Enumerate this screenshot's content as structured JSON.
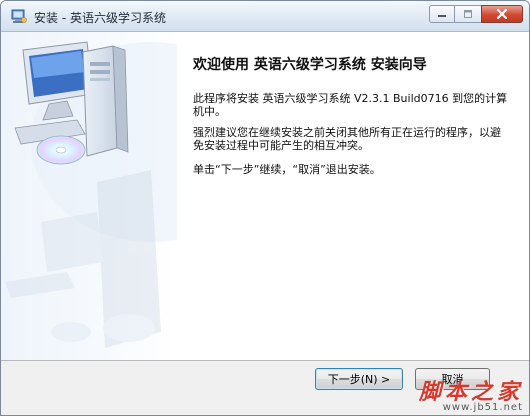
{
  "window": {
    "title": "安装 - 英语六级学习系统"
  },
  "content": {
    "heading": "欢迎使用 英语六级学习系统 安装向导",
    "para1": "此程序将安装 英语六级学习系统 V2.3.1 Build0716 到您的计算机中。",
    "para2": "强烈建议您在继续安装之前关闭其他所有正在运行的程序，以避免安装过程中可能产生的相互冲突。",
    "para3": "单击“下一步”继续，“取消”退出安装。"
  },
  "buttons": {
    "next": "下一步(N) >",
    "cancel": "取消"
  },
  "watermark": {
    "main": "脚本之家",
    "sub": "www.jb51.net"
  },
  "colors": {
    "titlebar": "#dfe9f4",
    "close": "#cf4a33",
    "watermark": "#d9382a"
  }
}
